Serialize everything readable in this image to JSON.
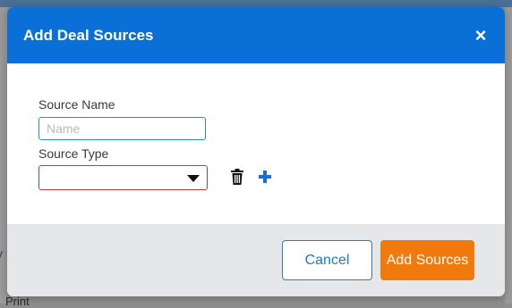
{
  "background": {
    "left_fragment": "y",
    "bottom_fragment": "Print"
  },
  "modal": {
    "title": "Add Deal Sources",
    "close_icon": "close-icon",
    "close_glyph": "×",
    "header_color": "#0a6fd6",
    "form": {
      "source_name_label": "Source Name",
      "source_name_value": "",
      "source_name_placeholder": "Name",
      "source_type_label": "Source Type",
      "source_type_value": "",
      "delete_icon": "trash-icon",
      "add_icon": "plus-icon"
    },
    "footer": {
      "cancel_label": "Cancel",
      "submit_label": "Add Sources",
      "submit_color": "#f07a0e"
    }
  }
}
